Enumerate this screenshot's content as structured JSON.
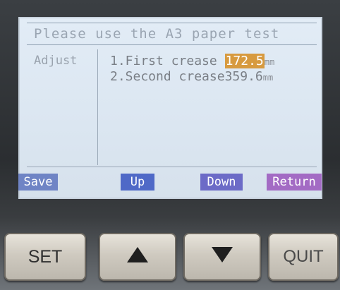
{
  "screen": {
    "title": "Please use the A3 paper test",
    "left_label": "Adjust",
    "items": [
      {
        "prefix": "1.First crease ",
        "value": "172.5",
        "unit": "mm"
      },
      {
        "prefix": "2.Second crease",
        "value": "359.6",
        "unit": "mm"
      }
    ],
    "softkeys": {
      "save": "Save",
      "up": "Up",
      "down": "Down",
      "return": "Return"
    }
  },
  "hardware_keys": {
    "set": "SET",
    "up_icon": "up-triangle-icon",
    "down_icon": "down-triangle-icon",
    "quit": "QUIT"
  },
  "colors": {
    "highlight": "#d79a3f",
    "save_key": "#6f84c5",
    "up_key": "#4f69c7",
    "down_key": "#6c6bc7",
    "return_key": "#a36bc4"
  }
}
